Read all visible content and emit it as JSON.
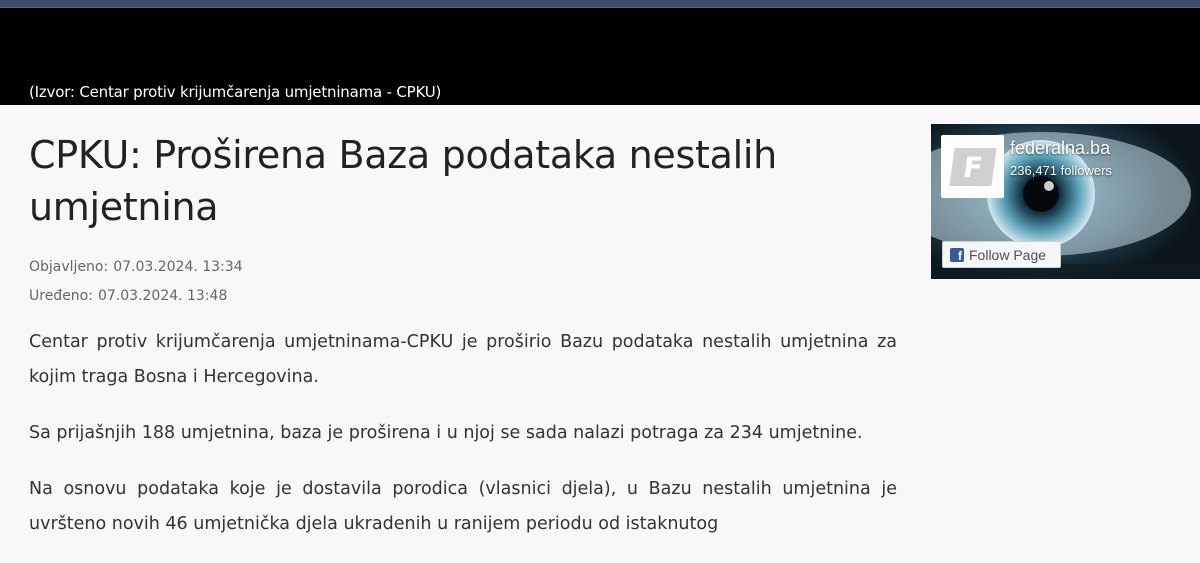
{
  "caption": {
    "text": "(Izvor: Centar protiv krijumčarenja umjetninama - CPKU)"
  },
  "article": {
    "title": "CPKU: Proširena Baza podataka nestalih umjetnina",
    "published_label": "Objavljeno:",
    "published_value": "07.03.2024. 13:34",
    "edited_label": "Uređeno:",
    "edited_value": "07.03.2024. 13:48",
    "paragraphs": [
      "Centar protiv krijumčarenja umjetninama-CPKU je proširio Bazu podataka nestalih umjetnina za kojim traga Bosna i Hercegovina.",
      "Sa prijašnjih 188 umjetnina, baza je proširena i u njoj se sada nalazi potraga za 234 umjetnine.",
      "Na osnovu podataka koje je dostavila porodica (vlasnici djela), u Bazu nestalih umjetnina je uvršteno novih 46 umjetnička djela ukradenih u ranijem periodu od istaknutog"
    ]
  },
  "fb_widget": {
    "page_name": "federalna.ba",
    "followers": "236,471 followers",
    "follow_label": "Follow Page",
    "logo_letter": "F",
    "icon": "facebook-icon",
    "brand_color": "#3b5998"
  }
}
